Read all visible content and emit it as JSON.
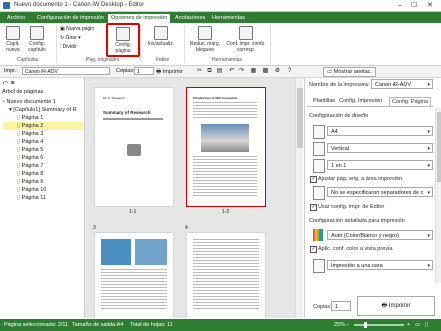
{
  "window": {
    "title": "Nuevo documento 1 - Canon iW Desktop - Editor"
  },
  "tabs": [
    "Archivo",
    "Configuración de impresión",
    "Opciones de impresión",
    "Anotaciones",
    "Herramientas"
  ],
  "ribbon": {
    "capit_nuevo": "Capít. nuevo",
    "config_capitulo": "Config. capítulo",
    "nueva_pagina": "Nueva págin",
    "girar": "Girar",
    "dividir": "Dividir",
    "config_pagina": "Config. página",
    "ins_actualiz": "Ins/actualiz.",
    "reduc_marg": "Reduc. márg. bloqueo",
    "conf_impr": "Conf. impr. comb. corresp.",
    "groups": {
      "capitulos": "Capítulos",
      "pag_originales": "Pág. originales",
      "indice": "Índice",
      "herramientas": "Herramientas"
    }
  },
  "toolbar": {
    "printer_label": "Impr.:",
    "printer_value": "Canon iR-ADV",
    "copies_label": "Copias:",
    "copies_value": "1",
    "print_label": "Imprimir",
    "show_notes_label": "Mostrar anotac."
  },
  "tree": {
    "root_label": "Árbol de páginas",
    "doc": "Nuevo documento 1",
    "chapter": "[Capítulo1] Summary of R",
    "pages": [
      "Página 1",
      "Página 2",
      "Página 3",
      "Página 4",
      "Página 5",
      "Página 6",
      "Página 7",
      "Página 8",
      "Página 9",
      "Página 10",
      "Página 11"
    ]
  },
  "thumbs": {
    "p1_caption": "1-1",
    "p2_caption": "1-2",
    "p3_number": "3",
    "p4_number": "4",
    "p1_title": "Summary of Research",
    "p1_sub": "Mr. K. Research",
    "p2_heading": "Introduction of ABC Innovation"
  },
  "right": {
    "printer_name_label": "Nombre de la impresora:",
    "printer_name_value": "Canon iR-ADV",
    "subtabs": [
      "Plantillas",
      "Config. Impresión",
      "Config. Página"
    ],
    "section_layout": "Configuración de diseño",
    "paper": "A4",
    "orientation": "Vertical",
    "layout": "1 en 1",
    "fit_page": "Ajustar pág. orig. a área impresión",
    "separators": "No se especificaron separadores de c",
    "use_editor": "Usar config. impr. de Editor",
    "section_detail": "Configuración detallada para impresión",
    "color": "Auto (Color/Blanco y negro)",
    "apply_color": "Aplic. conf. color a vista previa.",
    "sides": "Impresión a una cara",
    "copies_label": "Copias:",
    "copies_value": "1",
    "print_button": "Imprimir"
  },
  "status": {
    "selected": "Página seleccionada: 2/11",
    "size": "Tamaño de salida:A4",
    "sheets": "Total de hojas: 11",
    "zoom": "25%"
  },
  "colors": {
    "green": "#2e7d32",
    "red_highlight": "#e00000"
  }
}
